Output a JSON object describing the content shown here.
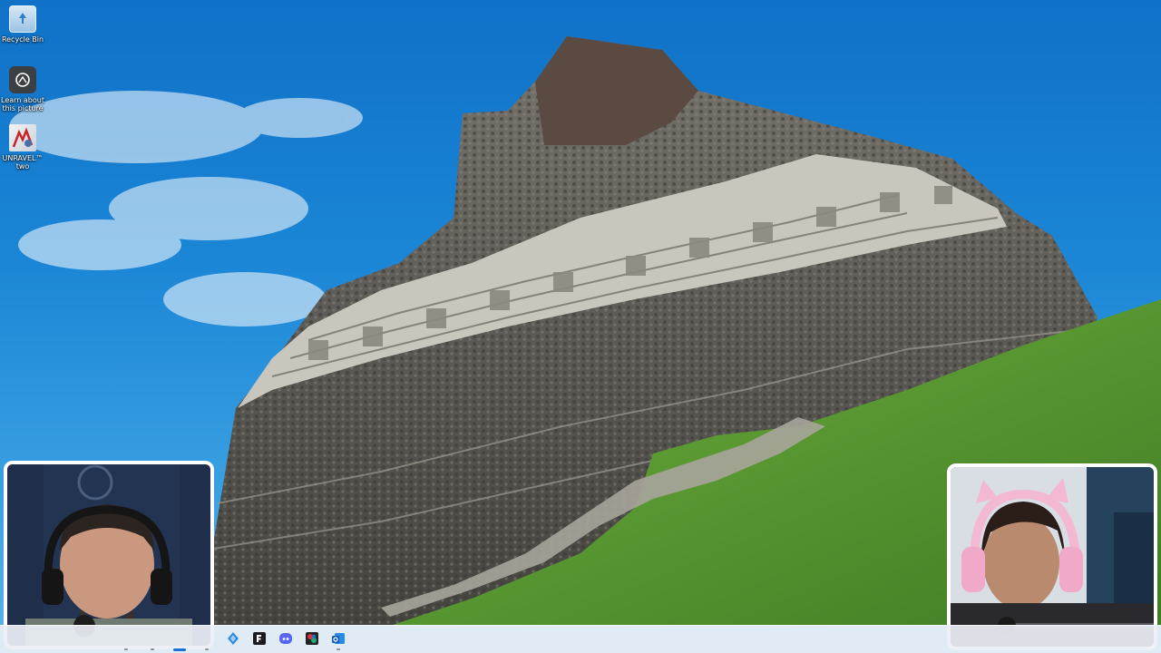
{
  "desktop": {
    "icons": [
      {
        "label": "Recycle Bin",
        "icon": "recycle-bin-icon"
      },
      {
        "label": "Learn about this picture",
        "icon": "camera-info-icon"
      },
      {
        "label": "UNRAVEL™ two",
        "icon": "unravel-game-icon"
      }
    ],
    "wallpaper": "Maya temple ruin with carved frieze against blue sky and green grass"
  },
  "webcams": {
    "left": {
      "subject": "streamer-with-headset"
    },
    "right": {
      "subject": "streamer-with-pink-cat-ear-headset"
    }
  },
  "taskbar": {
    "apps": [
      {
        "icon": "mail-app-icon"
      },
      {
        "icon": "epic-games-icon"
      },
      {
        "icon": "discord-icon"
      },
      {
        "icon": "photo-editor-icon"
      },
      {
        "icon": "outlook-icon"
      }
    ]
  },
  "colors": {
    "sky": "#1b86d6",
    "grass": "#5a9a34",
    "stone": "#6b6a64",
    "taskbar": "#eceff6",
    "accent": "#1a6fd6"
  }
}
